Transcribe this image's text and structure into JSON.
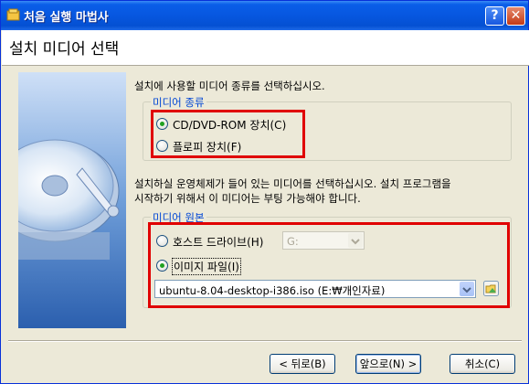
{
  "window": {
    "title": "처음 실행 마법사",
    "help_label": "?",
    "close_label": "✕"
  },
  "header": {
    "title": "설치 미디어 선택"
  },
  "instruction": "설치에 사용할 미디어 종류를 선택하십시오.",
  "media_type": {
    "legend": "미디어 종류",
    "options": [
      {
        "label": "CD/DVD-ROM 장치(C)",
        "selected": true
      },
      {
        "label": "플로피 장치(F)",
        "selected": false
      }
    ]
  },
  "description_lines": [
    "설치하실 운영체제가 들어 있는 미디어를 선택하십시오. 설치 프로그램을",
    "시작하기 위해서 이 미디어는 부팅 가능해야 합니다."
  ],
  "media_source": {
    "legend": "미디어 원본",
    "host_drive": {
      "label": "호스트 드라이브(H)",
      "selected": false,
      "drive_value": "G:"
    },
    "image_file": {
      "label": "이미지 파일(I)",
      "selected": true,
      "file_value": "ubuntu-8.04-desktop-i386.iso (E:₩개인자료)"
    }
  },
  "buttons": {
    "back": "< 뒤로(B)",
    "next": "앞으로(N) >",
    "cancel": "취소(C)"
  },
  "colors": {
    "titlebar": "#0757e0",
    "highlight_box": "#e00000",
    "radio_dot": "#21a121",
    "legend_text": "#0046d5"
  }
}
